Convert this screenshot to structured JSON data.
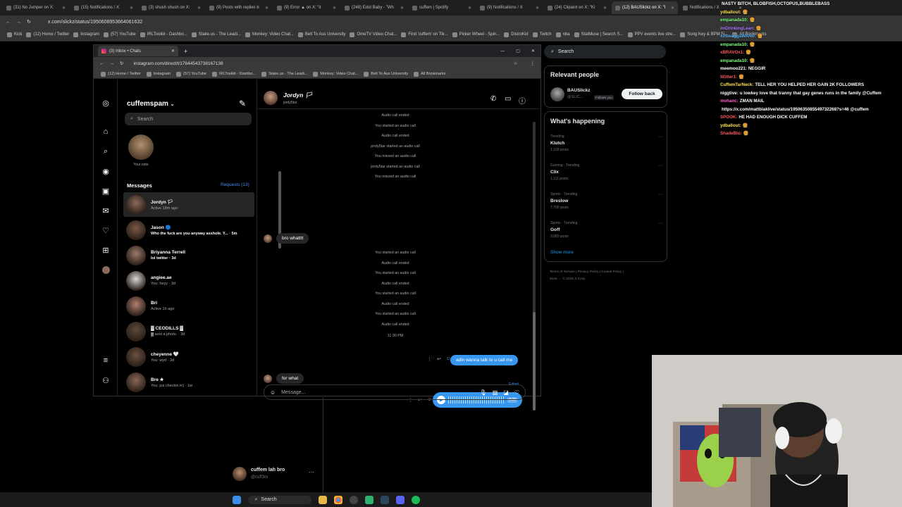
{
  "outer_tabs": [
    {
      "label": "(31) No Jumper on X:",
      "active": false
    },
    {
      "label": "(15) Notifications / X",
      "active": false
    },
    {
      "label": "(3) shush shush on X:",
      "active": false
    },
    {
      "label": "(9) Posts with replies b",
      "active": false
    },
    {
      "label": "(9) Error ▲ on X: \"it",
      "active": false
    },
    {
      "label": "(248) Edot Baby - \"Wh",
      "active": false
    },
    {
      "label": "cuffem | Spotify",
      "active": false
    },
    {
      "label": "(9) Notifications / X",
      "active": false
    },
    {
      "label": "(24) Clipalot on X: \"Ki",
      "active": false
    },
    {
      "label": "(12) BAUSlickz on X: \"I",
      "active": true
    },
    {
      "label": "Notifications / X",
      "active": false
    }
  ],
  "outer_url": "x.com/slickz/status/1950608953664061632",
  "outer_bookmarks": [
    "Kick",
    "(12) Home / Twitter",
    "Instagram",
    "(57) YouTube",
    "IRLToolkit - Dashbo...",
    "Stake.us - The Leadi...",
    "Monkey: Video Chat...",
    "Belt To Ass University",
    "OmeTV Video Chat...",
    "Find 'cuffem' on Tik...",
    "Picker Wheel - Spin...",
    "DistroKid",
    "Twitch",
    "nba",
    "StatMuse | Search S...",
    "PPV events live stre...",
    "Song Key & BPM Fi...",
    "All Bookmarks"
  ],
  "chat_overlay": [
    {
      "user": "",
      "text": "NASTY BITCH, BLOBFISH,OCTOPUS,BUBBLEBASS",
      "color": "#ffffff"
    },
    {
      "user": "ydballout:",
      "text": "🍔",
      "color": "#ffe14d"
    },
    {
      "user": "empanada10:",
      "text": "🍔",
      "color": "#7fff7f"
    },
    {
      "user": "imDrinkingLean:",
      "text": "🍔",
      "color": "#b07cff"
    },
    {
      "user": "x0SwaggaWANo:",
      "text": "🍔",
      "color": "#5cb8ff"
    },
    {
      "user": "empanada10:",
      "text": "🍔",
      "color": "#7fff7f"
    },
    {
      "user": "xBRAVOx1:",
      "text": "🍔",
      "color": "#ff5a5a"
    },
    {
      "user": "empanada10:",
      "text": "🍔",
      "color": "#7fff7f"
    },
    {
      "user": "meemoo221:",
      "text": "NEGGIR",
      "color": "#ffffff"
    },
    {
      "user": "lil1tter1:",
      "text": "🍔",
      "color": "#ff5a5a"
    },
    {
      "user": "CuffemTarNeck:",
      "text": "TELL HER YOU HELPED HER GAIN 2K FOLLOWERS",
      "color": "#ffe14d"
    },
    {
      "user": "niggtive:",
      "text": "u lowkey love that tranny that gay genes runs in the family @Cuffem",
      "color": "#ffffff"
    },
    {
      "user": "mohanc:",
      "text": "ZMAN MAIL",
      "color": "#ff66cc"
    },
    {
      "user": "",
      "text": "https://x.com/mattblaklive/status/1950635085549732268?s=46 @cuffem",
      "color": "#ffffff"
    },
    {
      "user": "SPOOK:",
      "text": "HE HAD ENOUGH DICK CUFFEM",
      "color": "#ff5a5a"
    },
    {
      "user": "ydballout:",
      "text": "🍔",
      "color": "#ffe14d"
    },
    {
      "user": "ShadeBlu:",
      "text": "🍔",
      "color": "#ff5a5a"
    }
  ],
  "inner": {
    "tab_label": "(3) Inbox • Chats",
    "url": "instagram.com/direct/t/17844543738167138",
    "bookmarks": [
      "(12) Home / Twitter",
      "Instagram",
      "(57) YouTube",
      "IRLToolkit - Dashbo...",
      "Stake.us - The Leadi...",
      "Monkey: Video Chat...",
      "Belt To Ass University",
      "All Bookmarks"
    ]
  },
  "ig": {
    "username": "cuffemspam",
    "search_placeholder": "Search",
    "note_label": "Your note",
    "messages_heading": "Messages",
    "requests_label": "Requests (13)",
    "conversations": [
      {
        "name": "Jordyn 🏳",
        "preview": "Active 18m ago",
        "selected": true,
        "bold": false,
        "avatar": "#8a6a5a"
      },
      {
        "name": "Jason 🔵",
        "preview": "Who the fuck are you anyway asshole. Y... · 5m",
        "selected": false,
        "bold": true,
        "avatar": "#7a5a45"
      },
      {
        "name": "Briyanna Terrell",
        "preview": "lol twitter · 3d",
        "selected": false,
        "bold": true,
        "avatar": "#9a7a6a"
      },
      {
        "name": "angiee.ae",
        "preview": "You: heyy · 3d",
        "selected": false,
        "bold": false,
        "avatar": "#d8d8d8"
      },
      {
        "name": "Bri",
        "preview": "Active 1h ago",
        "selected": false,
        "bold": false,
        "avatar": "#b08070"
      },
      {
        "name": "▓ CEODILLS ▓",
        "preview": "▓ sent a photo. · 3d",
        "selected": false,
        "bold": false,
        "avatar": "#5a4a3a"
      },
      {
        "name": "cheyenne 🤍",
        "preview": "You: wyd · 3d",
        "selected": false,
        "bold": false,
        "avatar": "#6a5040"
      },
      {
        "name": "Bre ★",
        "preview": "You: jus checkin in) · 1w",
        "selected": false,
        "bold": false,
        "avatar": "#8a6858"
      }
    ]
  },
  "thread": {
    "name": "Jordyn 🏳",
    "handle": "jordy5tar",
    "system_messages": [
      "Audio call ended",
      "You started an audio call",
      "Audio call ended",
      "jordy5tar started an audio call",
      "You missed an audio call",
      "jordy5tar started an audio call",
      "You missed an audio call"
    ],
    "incoming_1": "bro whatttt",
    "system_messages_2": [
      "You started an audio call",
      "Audio call ended",
      "You started an audio call",
      "Audio call ended",
      "You started an audio call",
      "Audio call ended",
      "You started an audio call",
      "Audio call ended"
    ],
    "timestamp": "11:30 PM",
    "edited_label": "Edited",
    "outgoing_1": "adin wanna talk to u call me",
    "incoming_2": "for what",
    "voice_duration": "0:23",
    "composer_placeholder": "Message..."
  },
  "x": {
    "search_placeholder": "Search",
    "relevant_heading": "Relevant people",
    "relevant_name": "BAUSlickz",
    "relevant_handle": "@SLIC...",
    "relevant_follows_you": "Follows you",
    "follow_back": "Follow back",
    "happening_heading": "What's happening",
    "trends": [
      {
        "context": "Trending",
        "title": "Klutch",
        "posts": "1,103 posts"
      },
      {
        "context": "Gaming · Trending",
        "title": "Clix",
        "posts": "1,111 posts"
      },
      {
        "context": "Sports · Trending",
        "title": "Breslow",
        "posts": "7,700 posts"
      },
      {
        "context": "Sports · Trending",
        "title": "Goff",
        "posts": "3,083 posts"
      }
    ],
    "show_more": "Show more",
    "footer_1": "Terms of Service  |  Privacy Policy  |  Cookie Policy  |",
    "footer_2": "More ···  © 2025 X Corp.",
    "account_name": "cuffem lah bro",
    "account_handle": "@cuff3m"
  },
  "taskbar": {
    "search_label": "Search"
  }
}
